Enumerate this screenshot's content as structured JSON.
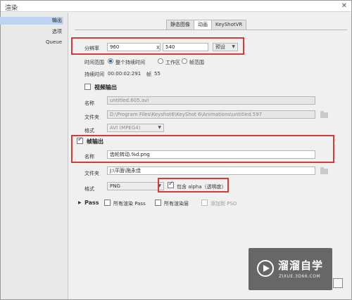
{
  "window": {
    "title": "渲染",
    "close_glyph": "✕"
  },
  "sidebar": {
    "items": [
      {
        "label": "输出",
        "active": true
      },
      {
        "label": "选项",
        "active": false
      },
      {
        "label": "Queue",
        "active": false
      }
    ]
  },
  "tabs": [
    {
      "label": "静态图像",
      "active": false
    },
    {
      "label": "动画",
      "active": true
    },
    {
      "label": "KeyShotVR",
      "active": false
    }
  ],
  "resolution": {
    "label": "分辨率",
    "width": "960",
    "x_sep": "X",
    "height": "540",
    "preset_label": "预设"
  },
  "time_range": {
    "label": "时间范围",
    "options": [
      "整个持续时间",
      "工作区",
      "帧范围"
    ],
    "selected": "整个持续时间"
  },
  "duration": {
    "label": "持续时间",
    "value": "00:00:02:291",
    "frames_label": "帧",
    "frames": "55"
  },
  "video_output": {
    "title": "视频输出",
    "checked": false,
    "name_label": "名称",
    "name_value": "untitled.605.avi",
    "folder_label": "文件夹",
    "folder_value": "D:\\Program Files\\Keyshot6\\KeyShot 6\\Animations\\untitled.597",
    "format_label": "格式",
    "format_value": "AVI (MPEG4)"
  },
  "frame_output": {
    "title": "帧输出",
    "checked": true,
    "name_label": "名称",
    "name_value": "齿轮转动.%d.png",
    "folder_label": "文件夹",
    "folder_value": "J:\\平面\\拖永佳",
    "format_label": "格式",
    "format_value": "PNG",
    "alpha_label": "包含 alpha（透明度）",
    "alpha_checked": true
  },
  "pass": {
    "label": "Pass",
    "options": [
      {
        "label": "所有渲染 Pass",
        "checked": false
      },
      {
        "label": "所有渲染层",
        "checked": false
      },
      {
        "label": "添加到 PSD",
        "checked": false,
        "disabled": true
      }
    ]
  },
  "watermark": {
    "name": "溜溜自学",
    "url": "ZIXUE.3D66.COM"
  },
  "colors": {
    "highlight": "#d33a3a",
    "accent": "#2a5db0",
    "sidebar_active": "#bcd4f0"
  }
}
